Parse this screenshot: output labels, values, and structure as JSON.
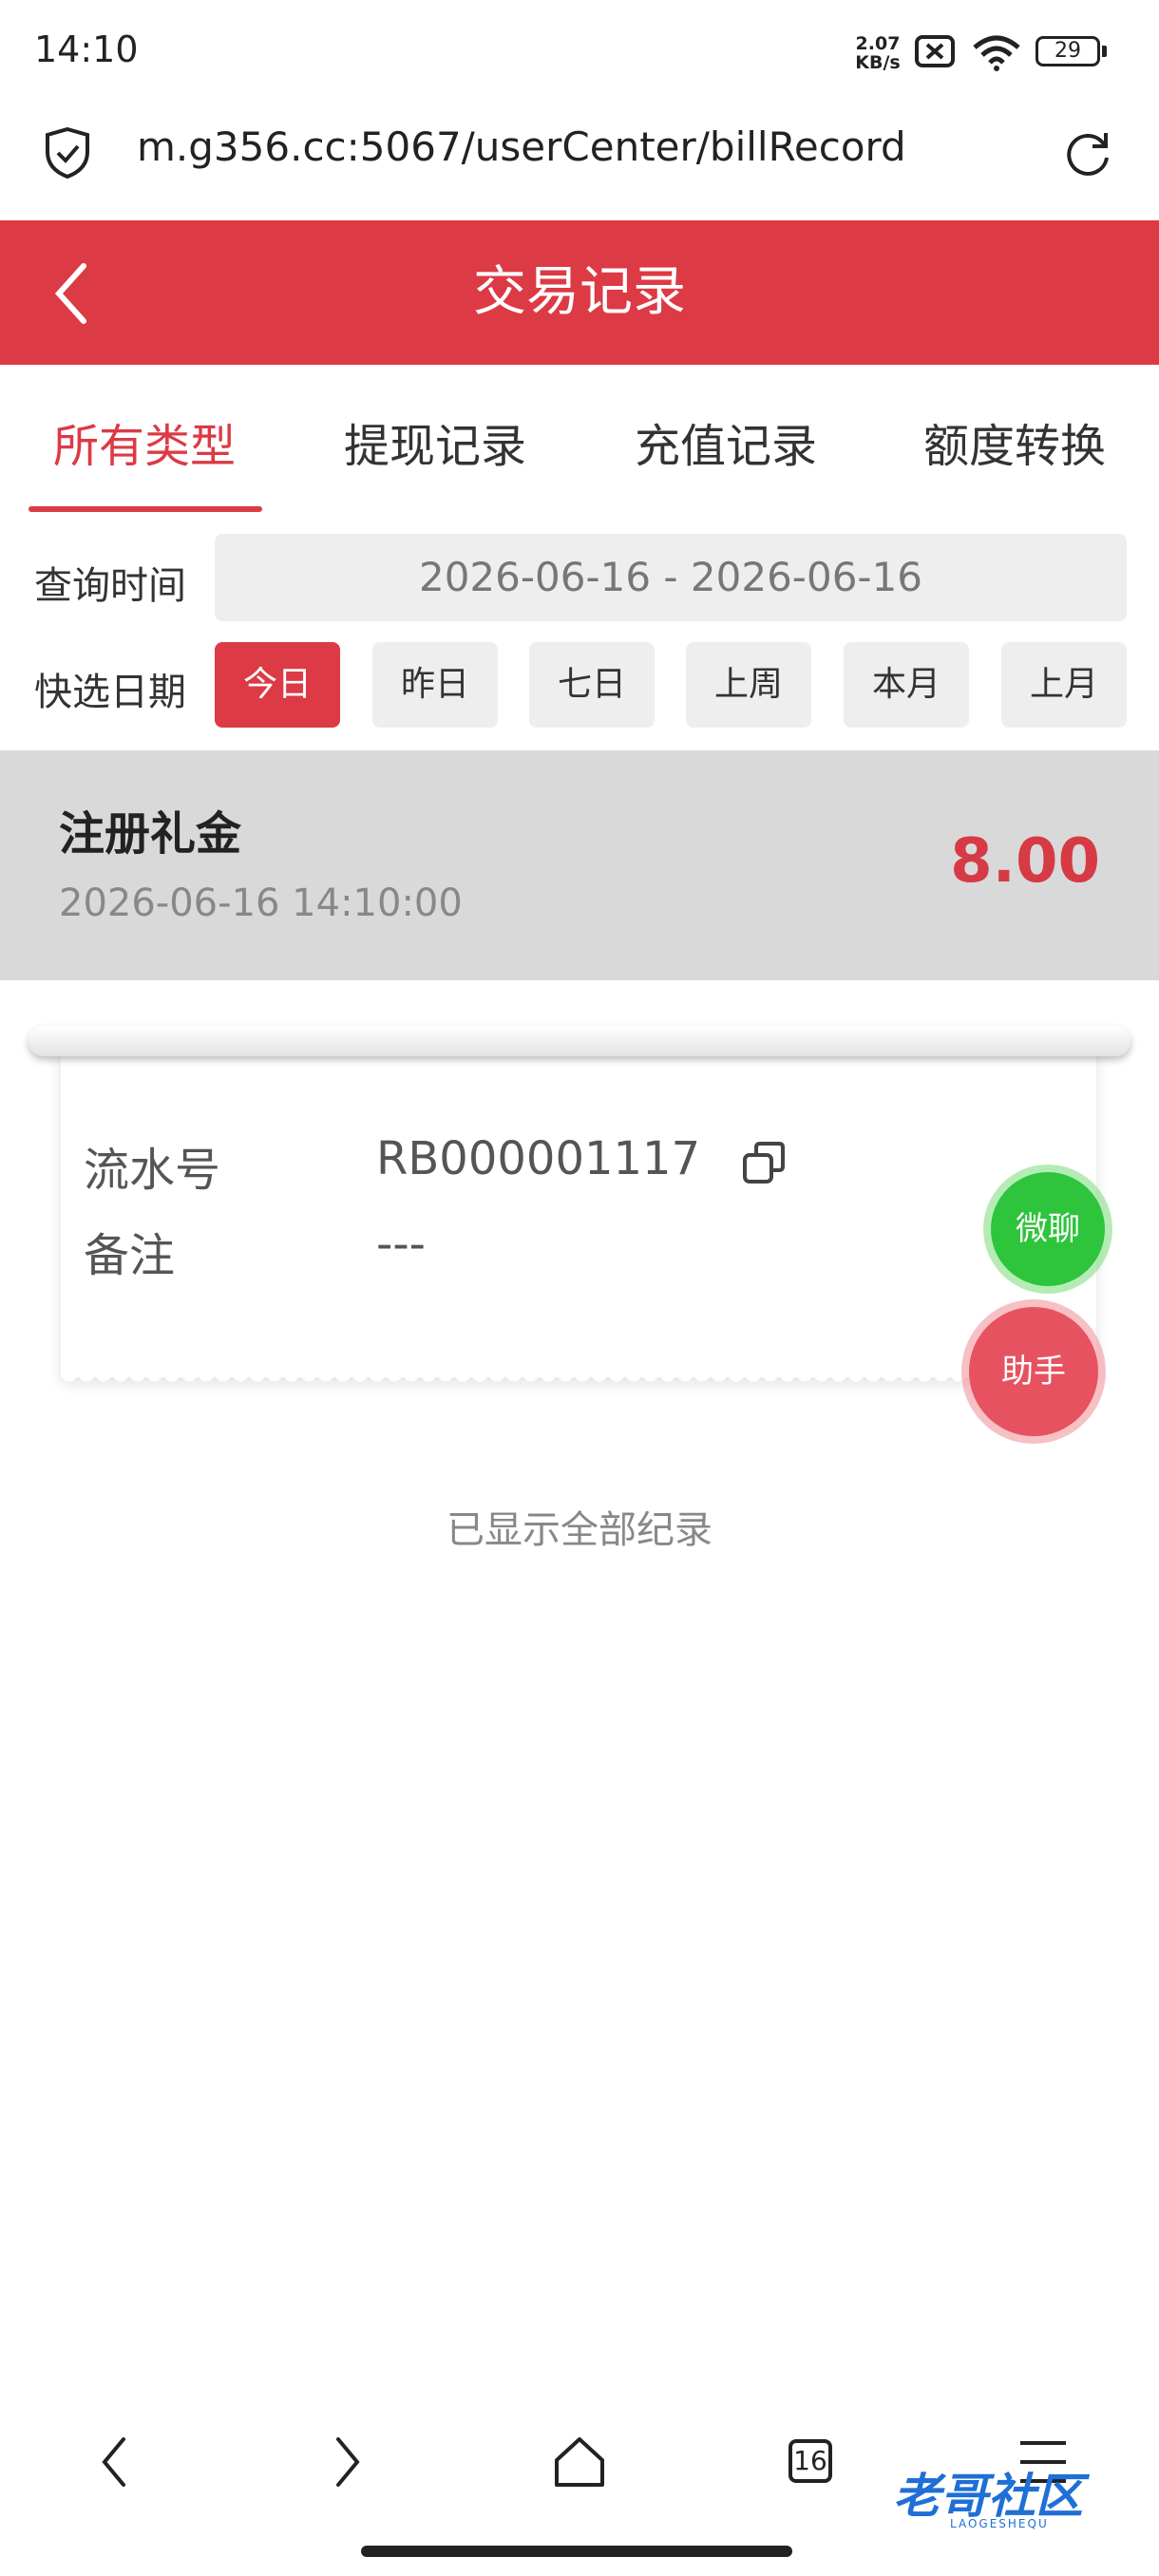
{
  "status_bar": {
    "time": "14:10",
    "net_speed_value": "2.07",
    "net_speed_unit": "KB/s",
    "battery": "29"
  },
  "browser": {
    "url": "m.g356.cc:5067/userCenter/billRecord",
    "tab_count": "16"
  },
  "header": {
    "title": "交易记录"
  },
  "tabs": [
    {
      "label": "所有类型",
      "active": true
    },
    {
      "label": "提现记录"
    },
    {
      "label": "充值记录"
    },
    {
      "label": "额度转换"
    }
  ],
  "query": {
    "time_label": "查询时间",
    "date_range": "2026-06-16 - 2026-06-16",
    "quick_label": "快选日期",
    "quick_options": [
      "今日",
      "昨日",
      "七日",
      "上周",
      "本月",
      "上月"
    ],
    "quick_active": "今日"
  },
  "record": {
    "title": "注册礼金",
    "time": "2026-06-16 14:10:00",
    "amount": "8.00",
    "serial_label": "流水号",
    "serial_value": "RB000001117",
    "remark_label": "备注",
    "remark_value": "---"
  },
  "fabs": {
    "chat": "微聊",
    "assistant": "助手"
  },
  "footer_note": "已显示全部纪录",
  "watermark": {
    "text": "老哥社区",
    "sub": "LAOGESHEQU"
  },
  "colors": {
    "accent": "#dc3a45",
    "green": "#2ec43c"
  },
  "icons": [
    "shield-check-icon",
    "reload-icon",
    "back-icon",
    "copy-icon",
    "wifi-icon",
    "sim-off-icon",
    "forward-icon",
    "home-icon",
    "menu-icon"
  ]
}
